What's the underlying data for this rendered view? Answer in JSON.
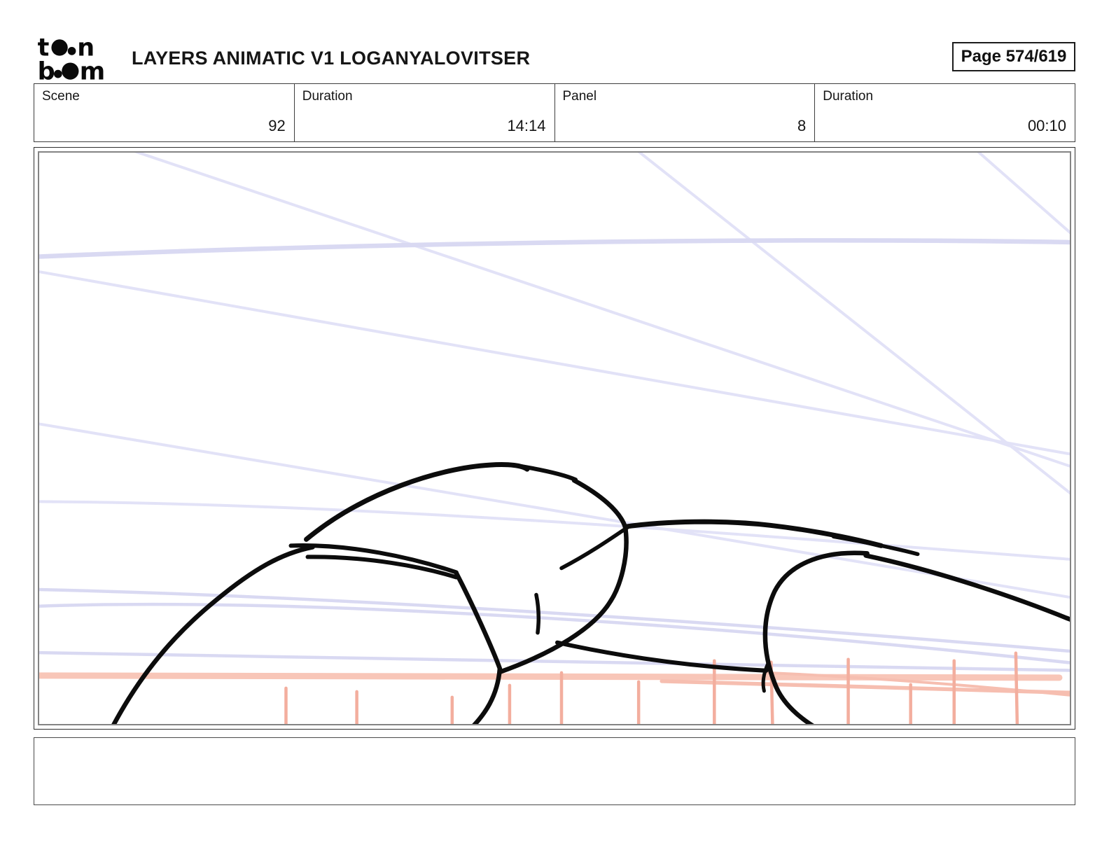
{
  "header": {
    "logo": {
      "alt": "toon boom",
      "line1_start": "t",
      "line1_end": "n",
      "line2_start": "b",
      "line2_end": "m"
    },
    "title": "LAYERS ANIMATIC V1 LOGANYALOVITSER",
    "page_label": "Page 574/619"
  },
  "info_bar": {
    "fields": [
      {
        "label": "Scene",
        "value": "92"
      },
      {
        "label": "Duration",
        "value": "14:14"
      },
      {
        "label": "Panel",
        "value": "8"
      },
      {
        "label": "Duration",
        "value": "00:10"
      }
    ]
  },
  "panel": {
    "caption": "",
    "colors": {
      "ink": "#0c0c0c",
      "guide_lavender": "#e2e2f7",
      "guide_lavender_strong": "#d9d9f2",
      "guide_salmon": "#f8c6b8",
      "guide_salmon_soft": "#f6beb0",
      "guide_salmon_tick": "#f3ae9e"
    }
  }
}
